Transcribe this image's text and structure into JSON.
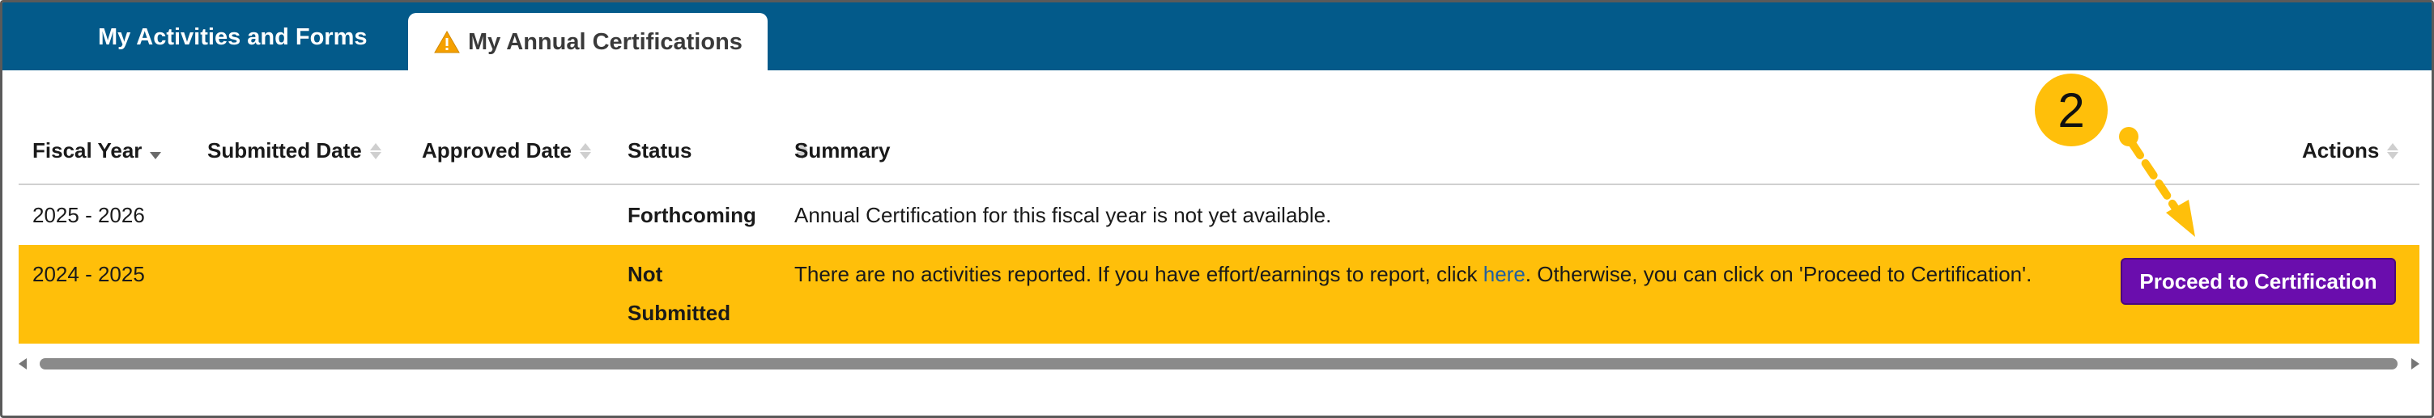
{
  "tabs": {
    "activities_label": "My Activities and Forms",
    "certifications_label": "My Annual Certifications"
  },
  "table": {
    "columns": {
      "fiscal_year": "Fiscal Year",
      "submitted_date": "Submitted Date",
      "approved_date": "Approved Date",
      "status": "Status",
      "summary": "Summary",
      "actions": "Actions"
    },
    "rows": [
      {
        "fiscal_year": "2025 - 2026",
        "submitted_date": "",
        "approved_date": "",
        "status": "Forthcoming",
        "summary": "Annual Certification for this fiscal year is not yet available."
      },
      {
        "fiscal_year": "2024 - 2025",
        "submitted_date": "",
        "approved_date": "",
        "status_line1": "Not",
        "status_line2": "Submitted",
        "summary_before": "There are no activities reported. If you have effort/earnings to report, click ",
        "summary_link": "here",
        "summary_after": ". Otherwise, you can click on 'Proceed to Certification'.",
        "action_label": "Proceed to Certification"
      }
    ]
  },
  "annotation": {
    "step_number": "2"
  },
  "colors": {
    "tabbar": "#035a8a",
    "highlight_row": "#ffbf0a",
    "action_button": "#6a0dad",
    "link": "#1f5fa0",
    "warning_icon": "#f5a000"
  },
  "icons": [
    "warning-icon",
    "sort-icon",
    "arrow-icon"
  ]
}
